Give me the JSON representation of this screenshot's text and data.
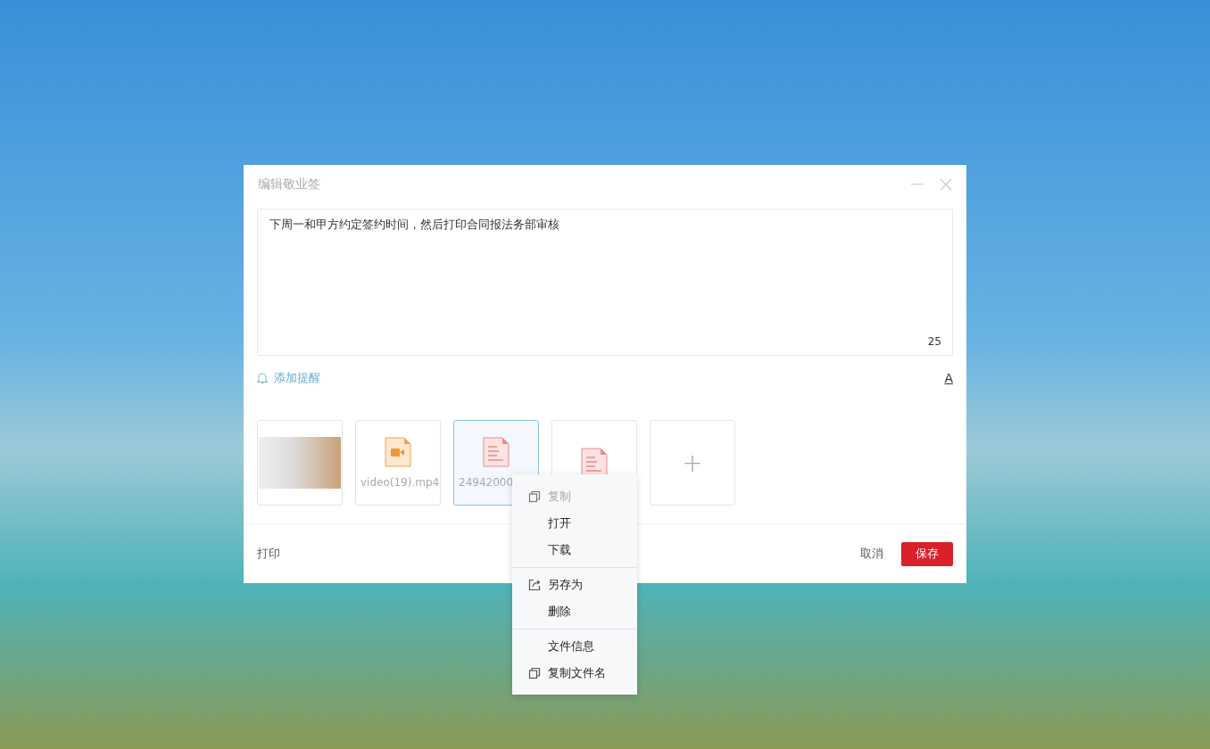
{
  "dialog": {
    "title": "编辑敬业签",
    "note": {
      "value": "下周一和甲方约定签约时间，然后打印合同报法务部审核",
      "count": "25"
    },
    "reminder": "添加提醒",
    "font_button": "A",
    "attachments": [
      {
        "kind": "image",
        "selected": false
      },
      {
        "kind": "video",
        "name": "video(19).mp4",
        "selected": false
      },
      {
        "kind": "document",
        "name": "24942000",
        "selected": true
      },
      {
        "kind": "document",
        "selected": false
      },
      {
        "kind": "add",
        "name": "+"
      }
    ],
    "print": "打印",
    "cancel": "取消",
    "save": "保存"
  },
  "context_menu": [
    {
      "kind": "copy",
      "label": "复制",
      "disabled": true
    },
    {
      "kind": "plain",
      "label": "打开",
      "disabled": false
    },
    {
      "kind": "plain",
      "label": "下载",
      "disabled": false
    },
    {
      "kind": "separator"
    },
    {
      "kind": "export",
      "label": "另存为",
      "disabled": false
    },
    {
      "kind": "plain",
      "label": "删除",
      "disabled": false
    },
    {
      "kind": "separator"
    },
    {
      "kind": "plain",
      "label": "文件信息",
      "disabled": false
    },
    {
      "kind": "copy",
      "label": "复制文件名",
      "disabled": false
    }
  ]
}
